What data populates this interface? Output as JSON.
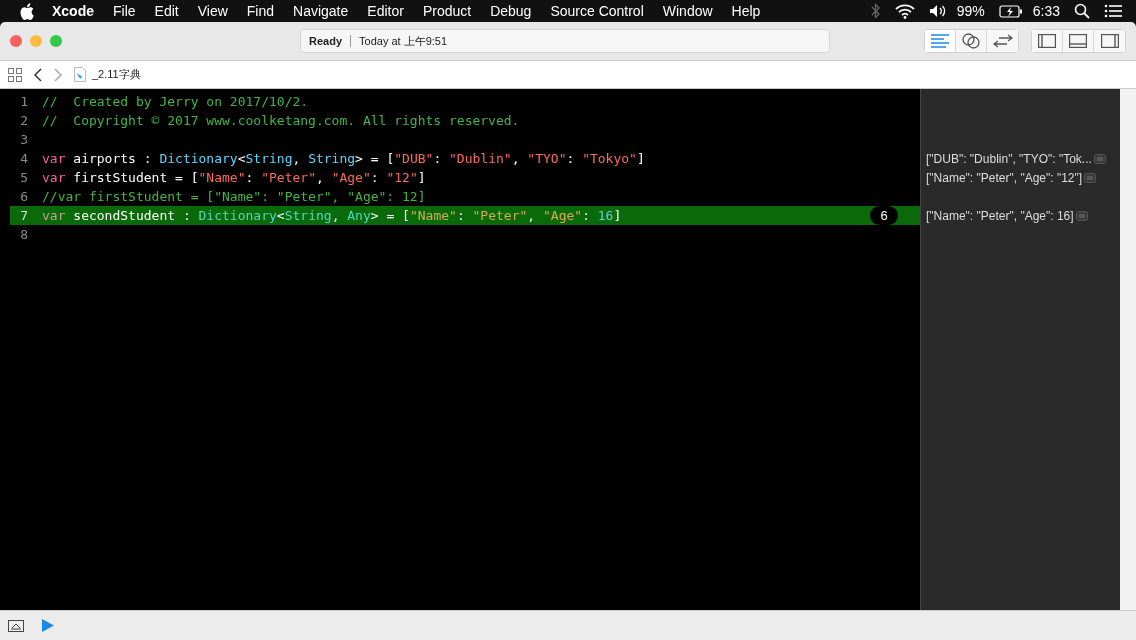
{
  "menu_bar": {
    "app": "Xcode",
    "items": [
      "File",
      "Edit",
      "View",
      "Find",
      "Navigate",
      "Editor",
      "Product",
      "Debug",
      "Source Control",
      "Window",
      "Help"
    ],
    "battery": "99%",
    "clock": "6:33"
  },
  "toolbar": {
    "status": "Ready",
    "activity": "Today at 上午9:51",
    "editor_modes": [
      {
        "kind": "standard",
        "selected": true
      },
      {
        "kind": "assistant",
        "selected": false
      },
      {
        "kind": "version",
        "selected": false
      }
    ]
  },
  "jump_bar": {
    "file": "_2.11字典"
  },
  "code": {
    "lines": [
      {
        "number": "1",
        "highlighted": false,
        "tokens": [
          {
            "kind": "comment",
            "text": "//  Created by Jerry on 2017/10/2."
          }
        ]
      },
      {
        "number": "2",
        "highlighted": false,
        "tokens": [
          {
            "kind": "comment",
            "text": "//  Copyright © 2017 www.coolketang.com. All rights reserved."
          }
        ]
      },
      {
        "number": "3",
        "highlighted": false
      },
      {
        "number": "4",
        "highlighted": false,
        "tokens": [
          {
            "kind": "keyword",
            "text": "var"
          },
          {
            "kind": "plain",
            "text": " airports : "
          },
          {
            "kind": "type",
            "text": "Dictionary"
          },
          {
            "kind": "plain",
            "text": "<"
          },
          {
            "kind": "type",
            "text": "String"
          },
          {
            "kind": "plain",
            "text": ", "
          },
          {
            "kind": "type",
            "text": "String"
          },
          {
            "kind": "plain",
            "text": "> = ["
          },
          {
            "kind": "string",
            "text": "\"DUB\""
          },
          {
            "kind": "plain",
            "text": ": "
          },
          {
            "kind": "string",
            "text": "\"Dublin\""
          },
          {
            "kind": "plain",
            "text": ", "
          },
          {
            "kind": "string",
            "text": "\"TYO\""
          },
          {
            "kind": "plain",
            "text": ": "
          },
          {
            "kind": "string",
            "text": "\"Tokyo\""
          },
          {
            "kind": "plain",
            "text": "]"
          }
        ],
        "result": "[\"DUB\": \"Dublin\", \"TYO\": \"Tok..."
      },
      {
        "number": "5",
        "highlighted": false,
        "tokens": [
          {
            "kind": "keyword",
            "text": "var"
          },
          {
            "kind": "plain",
            "text": " firstStudent = ["
          },
          {
            "kind": "string",
            "text": "\"Name\""
          },
          {
            "kind": "plain",
            "text": ": "
          },
          {
            "kind": "string",
            "text": "\"Peter\""
          },
          {
            "kind": "plain",
            "text": ", "
          },
          {
            "kind": "string",
            "text": "\"Age\""
          },
          {
            "kind": "plain",
            "text": ": "
          },
          {
            "kind": "string",
            "text": "\"12\""
          },
          {
            "kind": "plain",
            "text": "]"
          }
        ],
        "result": "[\"Name\": \"Peter\", \"Age\": \"12\"]"
      },
      {
        "number": "6",
        "highlighted": false,
        "tokens": [
          {
            "kind": "comment",
            "text": "//var firstStudent = [\"Name\": \"Peter\", \"Age\": 12]"
          }
        ]
      },
      {
        "number": "7",
        "highlighted": true,
        "tokens": [
          {
            "kind": "keyword",
            "text": "var"
          },
          {
            "kind": "plain",
            "text": " secondStudent : "
          },
          {
            "kind": "type",
            "text": "Dictionary"
          },
          {
            "kind": "plain",
            "text": "<"
          },
          {
            "kind": "type",
            "text": "String"
          },
          {
            "kind": "plain",
            "text": ", "
          },
          {
            "kind": "type",
            "text": "Any"
          },
          {
            "kind": "plain",
            "text": "> = ["
          },
          {
            "kind": "string",
            "text": "\"Name\""
          },
          {
            "kind": "plain",
            "text": ": "
          },
          {
            "kind": "string",
            "text": "\"Peter\""
          },
          {
            "kind": "plain",
            "text": ", "
          },
          {
            "kind": "string",
            "text": "\"Age\""
          },
          {
            "kind": "plain",
            "text": ": "
          },
          {
            "kind": "number",
            "text": "16"
          },
          {
            "kind": "plain",
            "text": "]"
          }
        ],
        "badge": "6",
        "result": "[\"Name\": \"Peter\", \"Age\": 16]"
      },
      {
        "number": "8",
        "highlighted": false
      }
    ]
  }
}
